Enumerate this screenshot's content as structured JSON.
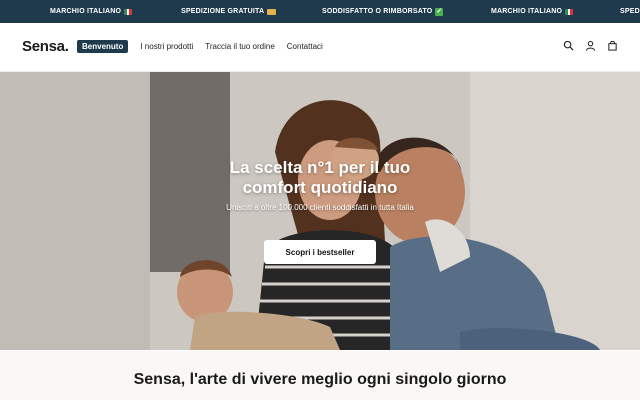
{
  "announcement": {
    "items": [
      {
        "text": "MARCHIO ITALIANO",
        "icon": "italian-flag-icon"
      },
      {
        "text": "SPEDIZIONE GRATUITA",
        "icon": "truck-icon"
      },
      {
        "text": "SODDISFATTO O RIMBORSATO",
        "icon": "check-icon"
      },
      {
        "text": "MARCHIO ITALIANO",
        "icon": "italian-flag-icon"
      },
      {
        "text": "SPEDIZIONE GRATUITA",
        "icon": "truck-icon"
      }
    ]
  },
  "header": {
    "logo": "Sensa.",
    "nav": [
      "Benvenuto",
      "I nostri prodotti",
      "Traccia il tuo ordine",
      "Contattaci"
    ],
    "icons": [
      "search-icon",
      "account-icon",
      "cart-icon"
    ]
  },
  "hero": {
    "title": "La scelta n°1 per il tuo comfort quotidiano",
    "subtitle": "Unisciti a oltre 100.000 clienti soddisfatti in tutta Italia",
    "cta": "Scopri i bestseller"
  },
  "section": {
    "title": "Sensa, l'arte di vivere meglio ogni singolo giorno"
  },
  "colors": {
    "brand_dark": "#1f3a4d",
    "cta_background": "#ffffff",
    "page_text": "#1a1a1a"
  }
}
